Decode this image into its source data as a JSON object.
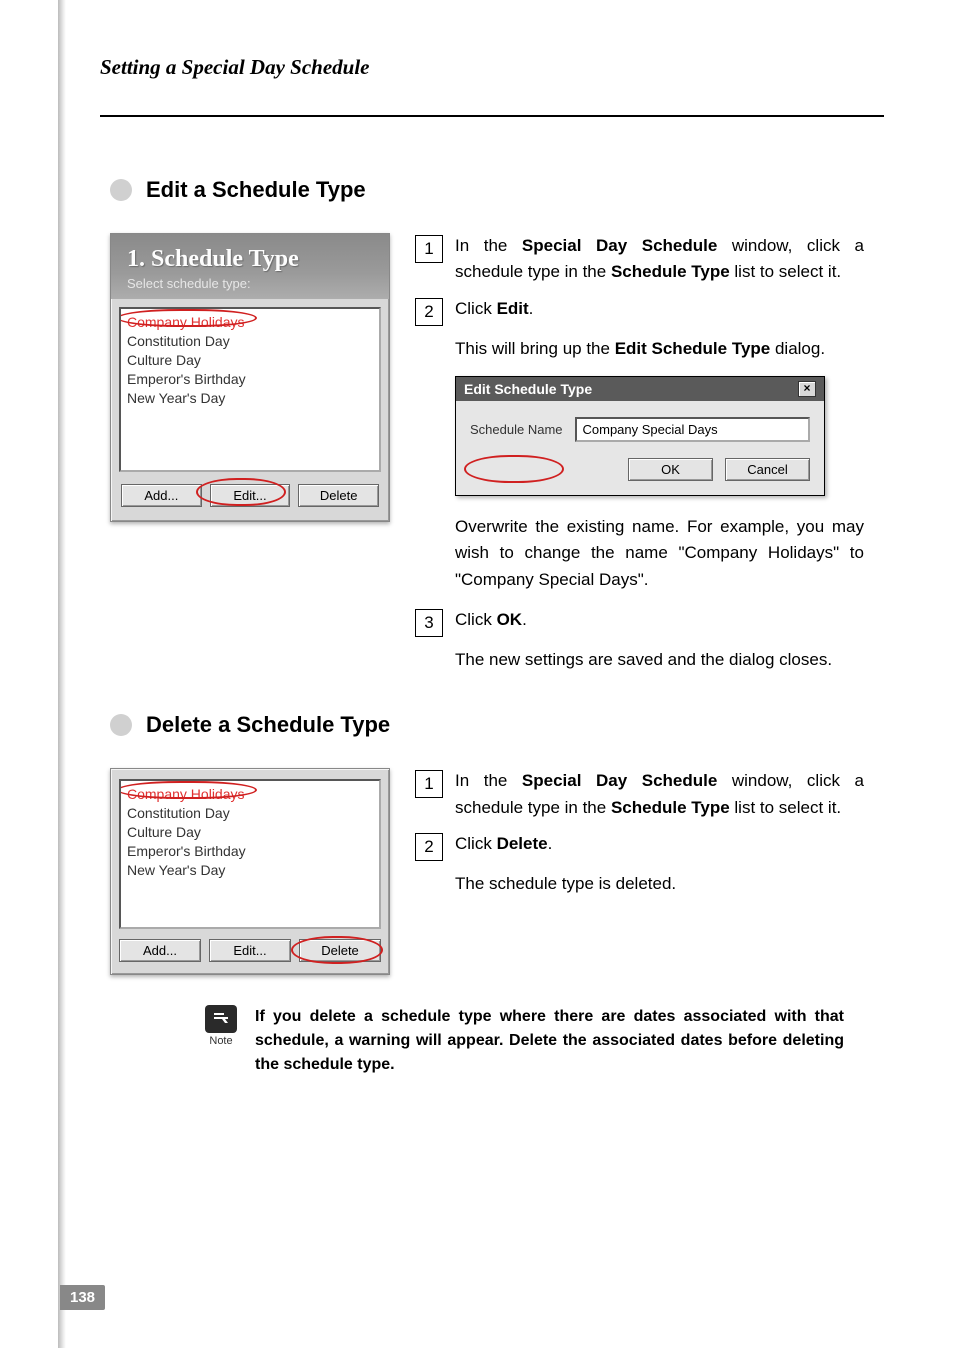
{
  "header": {
    "title": "Setting a Special Day Schedule"
  },
  "edit_section": {
    "title": "Edit a Schedule Type",
    "panel_title": "1. Schedule Type",
    "panel_sub": "Select schedule type:",
    "list": [
      "Company Holidays",
      "Constitution Day",
      "Culture Day",
      "Emperor's Birthday",
      "New Year's Day"
    ],
    "buttons": {
      "add": "Add...",
      "edit": "Edit...",
      "delete": "Delete"
    },
    "steps": {
      "s1_a": "In the ",
      "s1_b": "Special Day Schedule",
      "s1_c": " window, click a schedule type in the ",
      "s1_d": "Schedule Type",
      "s1_e": " list to select it.",
      "s2_a": "Click ",
      "s2_b": "Edit",
      "s2_c": ".",
      "s2_sub_a": "This will bring up the ",
      "s2_sub_b": "Edit Schedule Type",
      "s2_sub_c": " dialog.",
      "s2_after": "Overwrite the existing name. For example, you may wish to change the name \"Company Holidays\" to \"Company Special Days\".",
      "s3_a": "Click ",
      "s3_b": "OK",
      "s3_c": ".",
      "s3_sub": "The new settings are saved and the dialog closes."
    },
    "dialog": {
      "title": "Edit Schedule Type",
      "label": "Schedule Name",
      "value": "Company Special Days",
      "ok": "OK",
      "cancel": "Cancel"
    }
  },
  "delete_section": {
    "title": "Delete a Schedule Type",
    "list": [
      "Company Holidays",
      "Constitution Day",
      "Culture Day",
      "Emperor's Birthday",
      "New Year's Day"
    ],
    "buttons": {
      "add": "Add...",
      "edit": "Edit...",
      "delete": "Delete"
    },
    "steps": {
      "s1_a": "In the ",
      "s1_b": "Special Day Schedule",
      "s1_c": " window, click a schedule type in the ",
      "s1_d": "Schedule Type",
      "s1_e": " list to select it.",
      "s2_a": "Click ",
      "s2_b": "Delete",
      "s2_c": ".",
      "s2_sub": "The schedule type is deleted."
    }
  },
  "note": {
    "label": "Note",
    "text": "If you delete a schedule type where there are dates associated with that schedule, a warning will appear. Delete the associated dates before deleting the schedule type."
  },
  "page_number": "138",
  "nums": {
    "one": "1",
    "two": "2",
    "three": "3"
  }
}
